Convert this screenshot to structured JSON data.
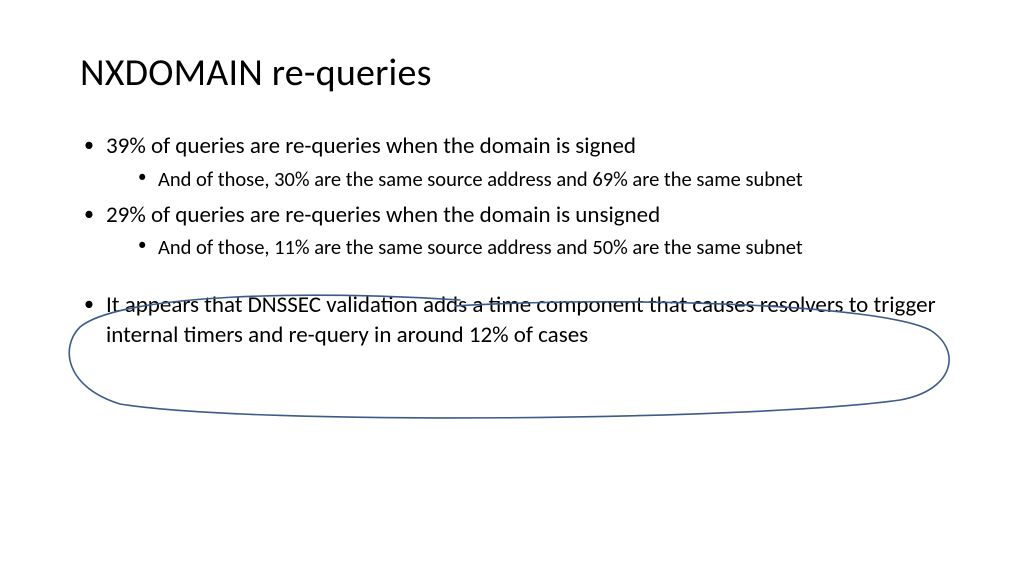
{
  "title": "NXDOMAIN re-queries",
  "bullets": [
    {
      "text": "39% of queries are re-queries when the domain is signed",
      "sub": "And of those, 30% are the same source address and 69% are the same subnet"
    },
    {
      "text": "29% of queries are re-queries when the domain is unsigned",
      "sub": "And of those, 11% are the same source address and 50% are the same subnet"
    },
    {
      "text": "It appears that DNSSEC validation adds a time component that causes resolvers to trigger internal timers and re-query in around 12% of cases"
    }
  ]
}
